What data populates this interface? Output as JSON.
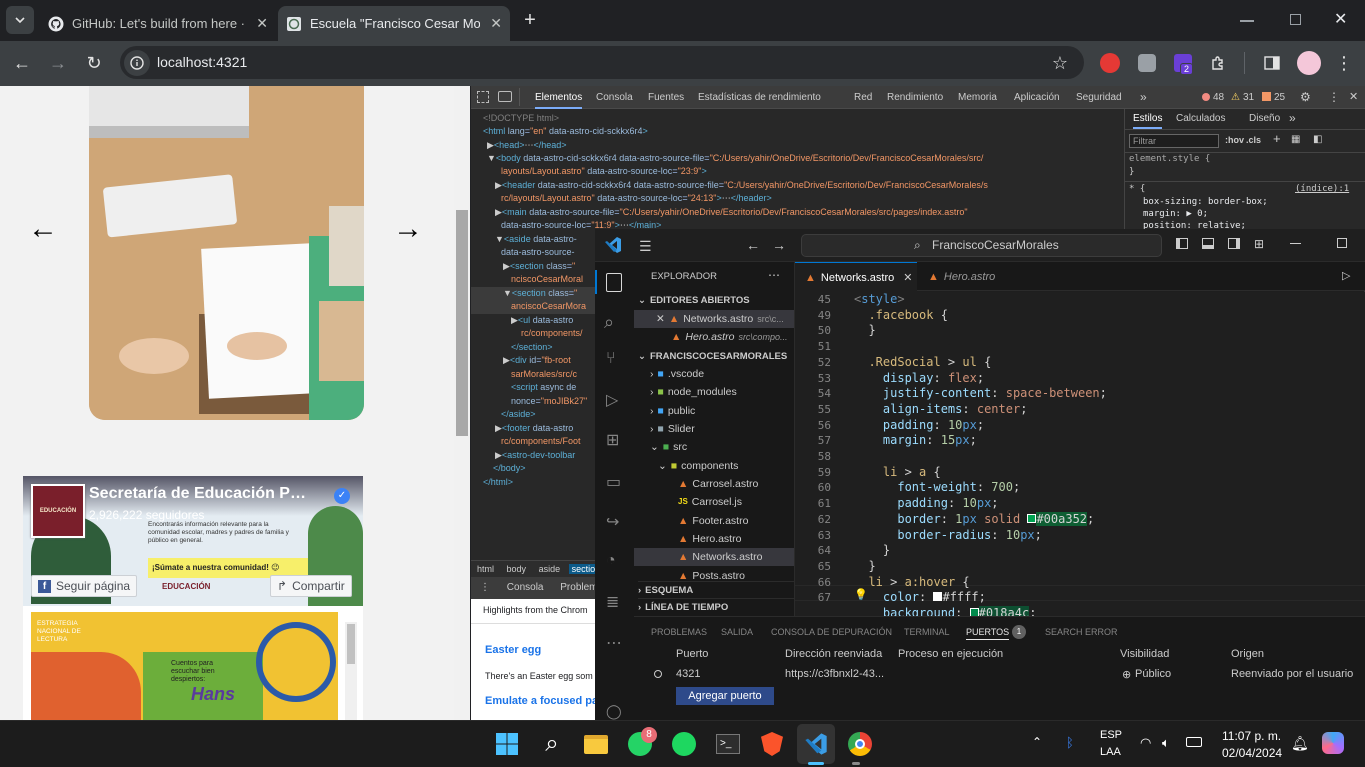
{
  "browser": {
    "tabs": [
      {
        "title": "GitHub: Let's build from here · GitHub",
        "active": false
      },
      {
        "title": "Escuela \"Francisco Cesar Morales\"",
        "active": true
      }
    ],
    "url": "localhost:4321",
    "extension_badge": "2"
  },
  "page": {
    "slider_prev": "←",
    "slider_next": "→",
    "fb": {
      "name": "Secretaría de Educación P…",
      "followers": "2,926,222 seguidores",
      "cover_text": "Encontrarás información relevante para la comunidad escolar, madres y padres de familia y público en general.",
      "cover_banner": "¡Súmate a nuestra comunidad! 😉",
      "cover_logo": "EDUCACIÓN",
      "avatar_text": "EDUCACIÓN",
      "follow": "Seguir página",
      "share": "Compartir",
      "post_label": "ESTRATEGIA NACIONAL DE LECTURA",
      "post_book_title": "Cuentos para escuchar bien despiertos:",
      "post_book_author": "Hans"
    }
  },
  "devtools": {
    "tabs": [
      "Elementos",
      "Consola",
      "Fuentes",
      "Estadísticas de rendimiento",
      "Red",
      "Rendimiento",
      "Memoria",
      "Aplicación",
      "Seguridad"
    ],
    "errors": "48",
    "warnings": "31",
    "issues": "25",
    "styles_tabs": [
      "Estilos",
      "Calculados",
      "Diseño"
    ],
    "filter_placeholder": "Filtrar",
    "hov": ":hov",
    "cls": ".cls",
    "element_style": "element.style {",
    "close_brace": "}",
    "rule_selector": "* {",
    "rule_source": "(índice):1",
    "rule_props": [
      "box-sizing: border-box;",
      "margin: ▶ 0;",
      "position: relative;"
    ],
    "breadcrumbs": [
      "html",
      "body",
      "aside",
      "section"
    ],
    "drawer_tabs": [
      "Consola",
      "Problemas"
    ],
    "drawer_text": [
      "Highlights from the Chrom",
      "Easter egg",
      "There's an Easter egg som",
      "Emulate a focused pa"
    ]
  },
  "vscode": {
    "search": "FranciscoCesarMorales",
    "explorer_title": "EXPLORADOR",
    "open_editors_title": "EDITORES ABIERTOS",
    "open_editors": [
      {
        "name": "Networks.astro",
        "path": "src\\c..."
      },
      {
        "name": "Hero.astro",
        "path": "src\\compo..."
      }
    ],
    "project_title": "FRANCISCOCESARMORALES",
    "tree": [
      {
        "name": ".vscode",
        "kind": "folder",
        "depth": 1
      },
      {
        "name": "node_modules",
        "kind": "folder",
        "depth": 1
      },
      {
        "name": "public",
        "kind": "folder",
        "depth": 1
      },
      {
        "name": "Slider",
        "kind": "folder",
        "depth": 1
      },
      {
        "name": "src",
        "kind": "folder-open",
        "depth": 1
      },
      {
        "name": "components",
        "kind": "folder-open",
        "depth": 2
      },
      {
        "name": "Carrosel.astro",
        "kind": "astro",
        "depth": 3
      },
      {
        "name": "Carrosel.js",
        "kind": "js",
        "depth": 3
      },
      {
        "name": "Footer.astro",
        "kind": "astro",
        "depth": 3
      },
      {
        "name": "Hero.astro",
        "kind": "astro",
        "depth": 3
      },
      {
        "name": "Networks.astro",
        "kind": "astro",
        "depth": 3
      },
      {
        "name": "Posts.astro",
        "kind": "astro",
        "depth": 3
      }
    ],
    "outline_title": "ESQUEMA",
    "timeline_title": "LÍNEA DE TIEMPO",
    "editor_tabs": [
      "Networks.astro",
      "Hero.astro"
    ],
    "panel_tabs": [
      "PROBLEMAS",
      "SALIDA",
      "CONSOLA DE DEPURACIÓN",
      "TERMINAL",
      "PUERTOS",
      "SEARCH ERROR"
    ],
    "ports_count": "1",
    "ports_headers": [
      "Puerto",
      "Dirección reenviada",
      "Proceso en ejecución",
      "Visibilidad",
      "Origen"
    ],
    "ports_row": [
      "4321",
      "https://c3fbnxl2-43...",
      "",
      "Público",
      "Reenviado por el usuario"
    ],
    "add_port": "Agregar puerto"
  },
  "taskbar": {
    "lang": "ESP",
    "layout": "LAA",
    "time": "11:07 p. m.",
    "date": "02/04/2024",
    "whatsapp_badge": "8"
  }
}
